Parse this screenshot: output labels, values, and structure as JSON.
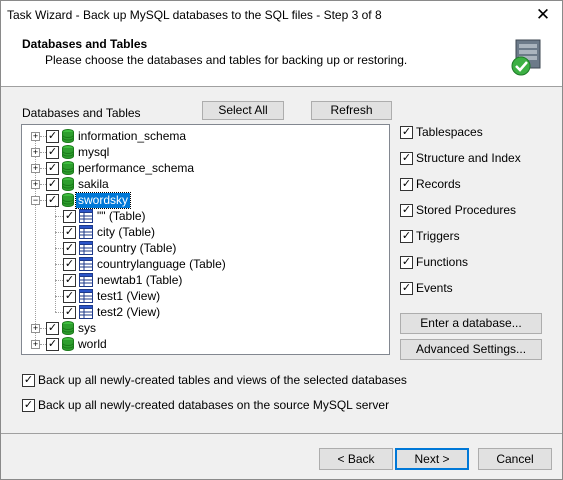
{
  "window": {
    "title": "Task Wizard - Back up MySQL databases to the SQL files - Step 3 of 8"
  },
  "banner": {
    "title": "Databases and Tables",
    "subtitle": "Please choose the databases and tables for backing up or restoring."
  },
  "tree_label": "Databases and Tables",
  "buttons": {
    "select_all": "Select All",
    "refresh": "Refresh",
    "enter_db": "Enter a database...",
    "advanced": "Advanced Settings...",
    "back": "< Back",
    "next": "Next >",
    "cancel": "Cancel"
  },
  "tree": {
    "databases": [
      {
        "name": "information_schema",
        "checked": true
      },
      {
        "name": "mysql",
        "checked": true
      },
      {
        "name": "performance_schema",
        "checked": true
      },
      {
        "name": "sakila",
        "checked": true
      },
      {
        "name": "swordsky",
        "checked": true,
        "selected": true,
        "expanded": true
      },
      {
        "name": "sys",
        "checked": true
      },
      {
        "name": "world",
        "checked": true
      }
    ],
    "children": [
      {
        "name": "\"\" (Table)",
        "checked": true
      },
      {
        "name": "city (Table)",
        "checked": true
      },
      {
        "name": "country (Table)",
        "checked": true
      },
      {
        "name": "countrylanguage (Table)",
        "checked": true
      },
      {
        "name": "newtab1 (Table)",
        "checked": true
      },
      {
        "name": "test1 (View)",
        "checked": true
      },
      {
        "name": "test2 (View)",
        "checked": true
      }
    ]
  },
  "options": [
    {
      "label": "Tablespaces",
      "checked": true
    },
    {
      "label": "Structure and Index",
      "checked": true
    },
    {
      "label": "Records",
      "checked": true
    },
    {
      "label": "Stored Procedures",
      "checked": true
    },
    {
      "label": "Triggers",
      "checked": true
    },
    {
      "label": "Functions",
      "checked": true
    },
    {
      "label": "Events",
      "checked": true
    }
  ],
  "bottom_options": [
    {
      "label": "Back up all newly-created tables and views of the selected databases",
      "checked": true
    },
    {
      "label": "Back up all newly-created databases on the source MySQL server",
      "checked": true
    }
  ],
  "icons": {
    "database": "database-icon",
    "table": "table-icon",
    "wizard": "database-check-icon"
  },
  "colors": {
    "selection": "#0078d7",
    "db_green": "#2e9e2e",
    "check_green": "#3cb043"
  }
}
